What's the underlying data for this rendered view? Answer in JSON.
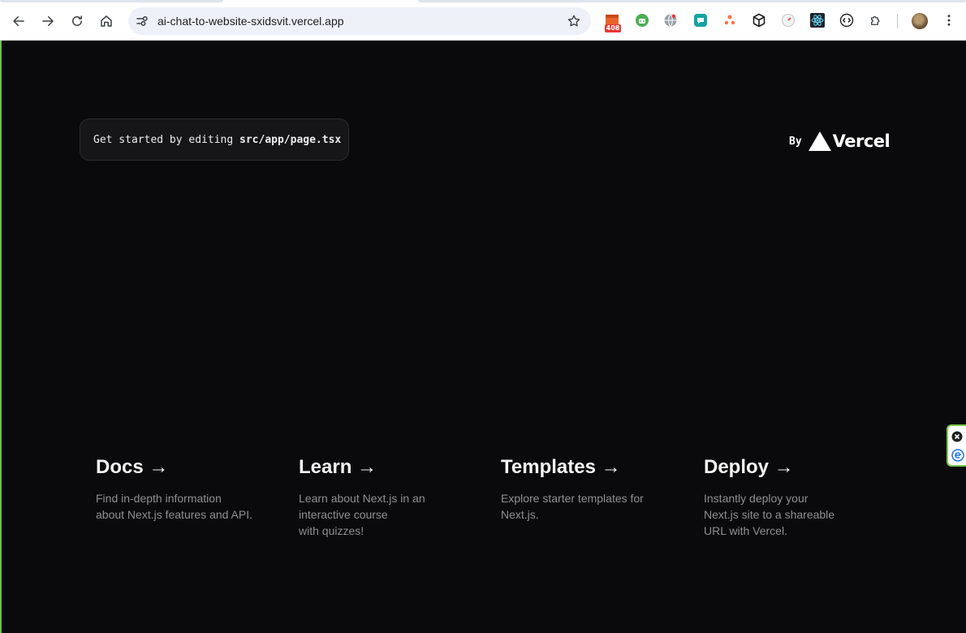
{
  "browser": {
    "url": "ai-chat-to-website-sxidsvit.vercel.app",
    "extension_badge": "408",
    "icons": [
      "back-icon",
      "forward-icon",
      "reload-icon",
      "home-icon",
      "site-info-icon",
      "bookmark-star-icon",
      "extensions-puzzle-icon",
      "chrome-menu-icon"
    ]
  },
  "page": {
    "code_hint_prefix": "Get started by editing ",
    "code_hint_file": "src/app/page.tsx",
    "by_label": "By",
    "vercel_word": "Vercel",
    "cards": [
      {
        "title": "Docs →",
        "desc_lines": [
          "Find in-depth information",
          "about Next.js features and API."
        ]
      },
      {
        "title": "Learn →",
        "desc_lines": [
          "Learn about Next.js in an",
          "interactive course",
          "with quizzes!"
        ]
      },
      {
        "title": "Templates →",
        "desc_lines": [
          "Explore starter templates for",
          "Next.js."
        ]
      },
      {
        "title": "Deploy →",
        "desc_lines": [
          "Instantly deploy your",
          "Next.js site to a shareable",
          "URL with Vercel."
        ]
      }
    ]
  },
  "colors": {
    "page_background": "#0a0a0c",
    "card_title": "#f4f4f4",
    "card_desc": "#8f8f92",
    "edge_border": "#6cc24a"
  }
}
